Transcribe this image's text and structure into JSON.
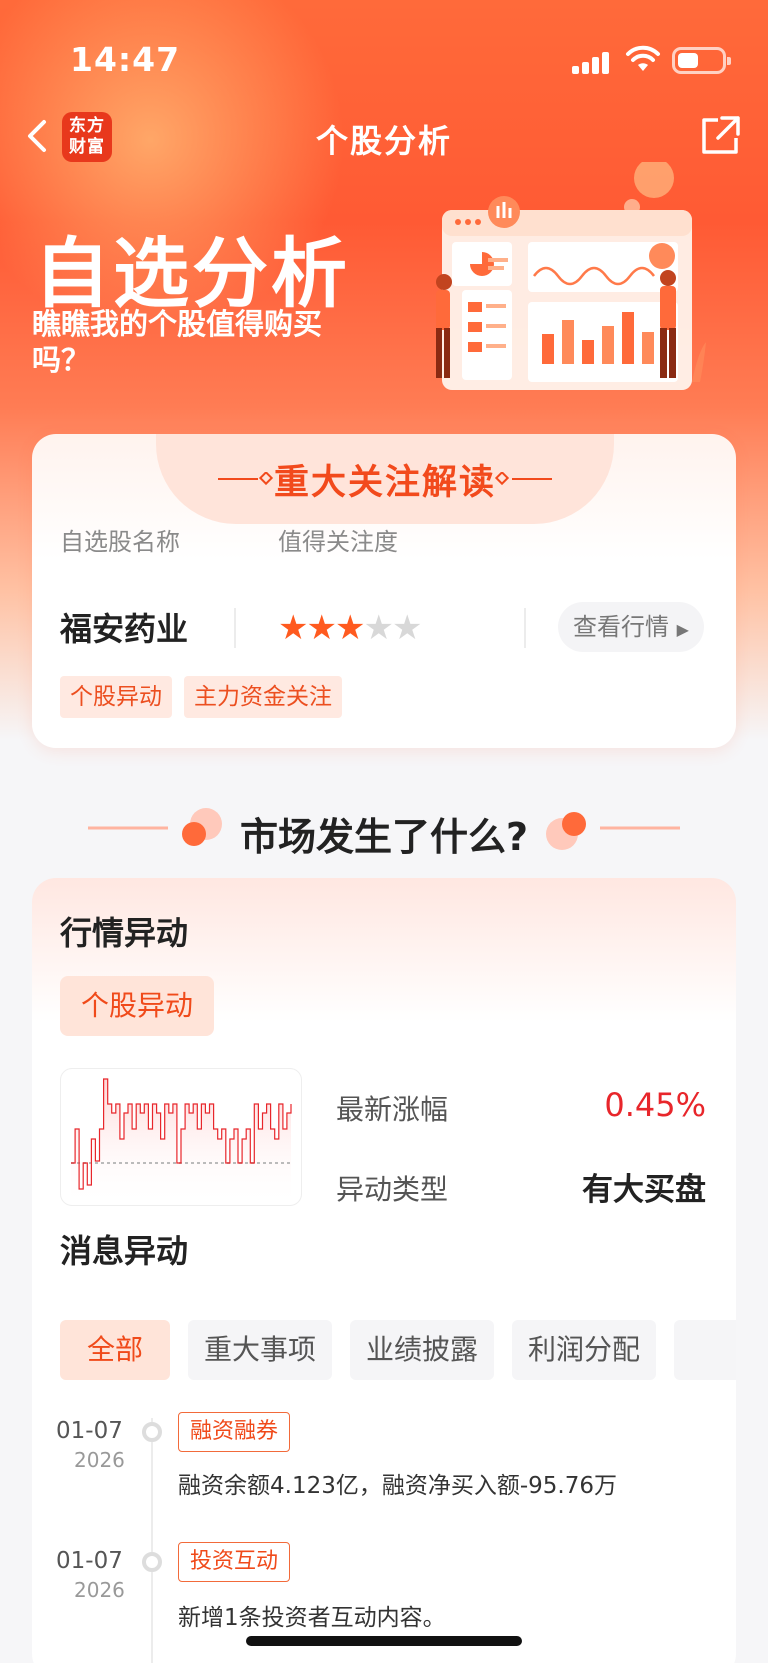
{
  "status": {
    "time": "14:47"
  },
  "nav": {
    "logo_line1": "东方",
    "logo_line2": "财富",
    "title": "个股分析"
  },
  "banner": {
    "title": "自选分析",
    "subtitle": "瞧瞧我的个股值得购买吗？"
  },
  "focus_card": {
    "header": "重大关注解读",
    "stock_label": "自选股名称",
    "attention_label": "值得关注度",
    "stock_name": "福安药业",
    "rating": 3,
    "rating_max": 5,
    "quote_button": "查看行情",
    "tags": [
      "个股异动",
      "主力资金关注"
    ]
  },
  "section": {
    "title": "市场发生了什么?"
  },
  "market_card": {
    "heading": "行情异动",
    "pill": "个股异动",
    "latest_change_label": "最新涨幅",
    "latest_change_value": "0.45%",
    "type_label": "异动类型",
    "type_value": "有大买盘",
    "news_heading": "消息异动",
    "filters": [
      "全部",
      "重大事项",
      "业绩披露",
      "利润分配"
    ],
    "timeline": [
      {
        "date": "01-07",
        "year": "2026",
        "tag": "融资融券",
        "text": "融资余额4.123亿，融资净买入额-95.76万"
      },
      {
        "date": "01-07",
        "year": "2026",
        "tag": "投资互动",
        "text": "新增1条投资者互动内容。"
      }
    ]
  },
  "colors": {
    "accent": "#f04a1a",
    "up_red": "#e8262b",
    "hero": "#ff5a34"
  }
}
